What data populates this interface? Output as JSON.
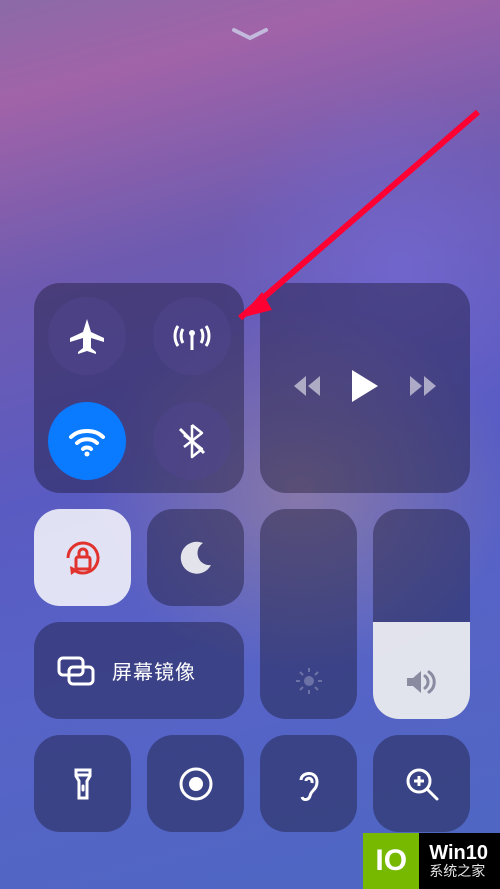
{
  "screen_mirroring_label": "屏幕镜像",
  "icons": {
    "airplane": "airplane-icon",
    "cellular": "cellular-data-icon",
    "wifi": "wifi-icon",
    "bluetooth": "bluetooth-off-icon",
    "orientation_lock": "orientation-lock-icon",
    "dnd": "moon-icon",
    "rewind": "rewind-icon",
    "play": "play-icon",
    "forward": "forward-icon",
    "brightness": "brightness-icon",
    "volume": "volume-icon",
    "mirror": "screen-mirror-icon",
    "flashlight": "flashlight-icon",
    "record": "screen-record-icon",
    "hearing": "hearing-icon",
    "magnifier": "magnifier-icon",
    "chevron": "chevron-down-icon"
  },
  "states": {
    "airplane_on": false,
    "cellular_on": false,
    "wifi_on": true,
    "bluetooth_on": false,
    "orientation_lock_on": true,
    "dnd_on": false
  },
  "volume_percent": 46,
  "brightness_percent": 0,
  "annotation": {
    "target": "cellular-data-icon",
    "kind": "red-arrow"
  },
  "watermark": {
    "badge": "IO",
    "line1": "Win10",
    "line2": "系统之家"
  }
}
